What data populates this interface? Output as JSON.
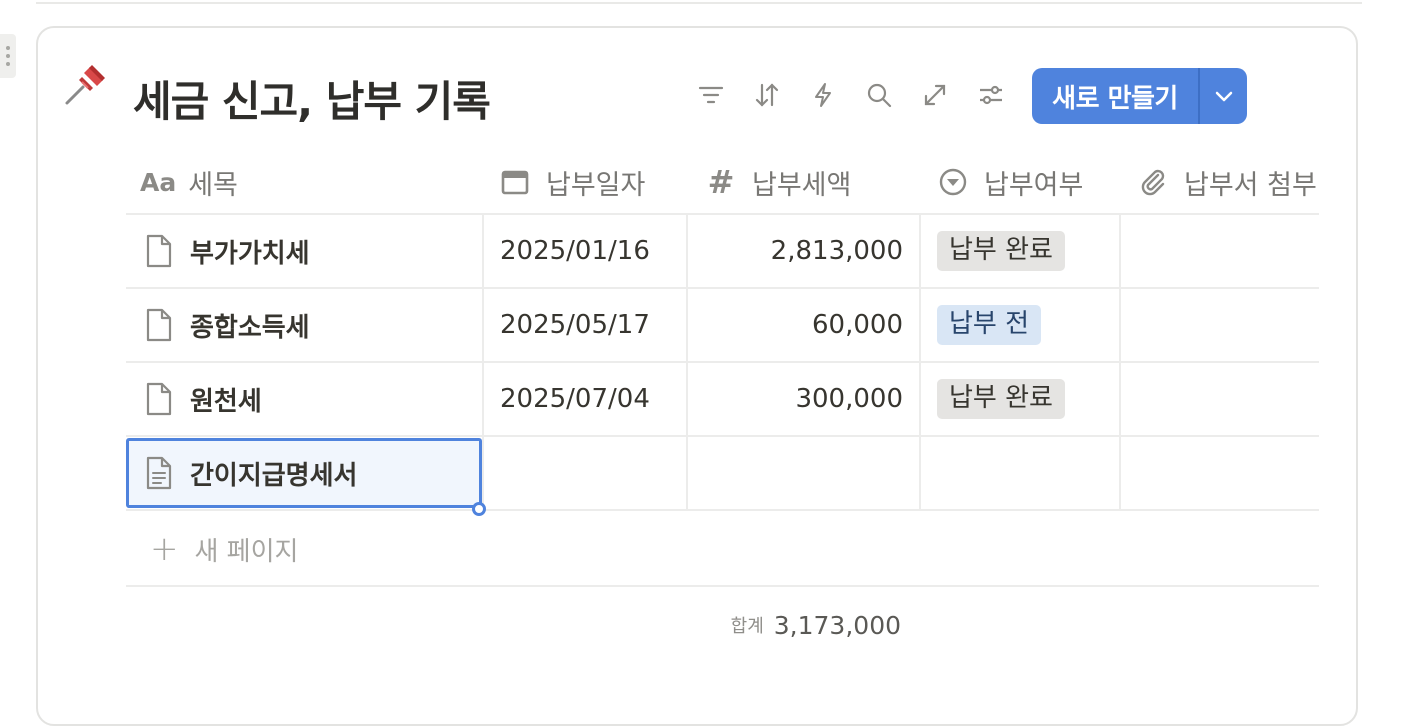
{
  "database": {
    "title": "세금 신고, 납부 기록",
    "icon": "pushpin-icon",
    "new_button_label": "새로 만들기"
  },
  "toolbar": {
    "icons": [
      "filter-icon",
      "sort-icon",
      "automation-icon",
      "search-icon",
      "expand-icon",
      "settings-sliders-icon"
    ]
  },
  "columns": [
    {
      "label": "세목",
      "icon": "text-type-icon"
    },
    {
      "label": "납부일자",
      "icon": "calendar-icon"
    },
    {
      "label": "납부세액",
      "icon": "number-icon"
    },
    {
      "label": "납부여부",
      "icon": "status-icon"
    },
    {
      "label": "납부서 첨부",
      "icon": "attachment-icon"
    }
  ],
  "rows": [
    {
      "title": "부가가치세",
      "date": "2025/01/16",
      "amount": "2,813,000",
      "status": "납부 완료",
      "status_type": "done"
    },
    {
      "title": "종합소득세",
      "date": "2025/05/17",
      "amount": "60,000",
      "status": "납부 전",
      "status_type": "pending"
    },
    {
      "title": "원천세",
      "date": "2025/07/04",
      "amount": "300,000",
      "status": "납부 완료",
      "status_type": "done"
    },
    {
      "title": "간이지급명세서",
      "date": "",
      "amount": "",
      "status": "",
      "status_type": ""
    }
  ],
  "new_page_label": "새 페이지",
  "summary": {
    "label": "합계",
    "value": "3,173,000"
  },
  "colors": {
    "accent": "#4f83dd",
    "badge_done": "#e5e4e2",
    "badge_pending": "#d9e6f5"
  }
}
